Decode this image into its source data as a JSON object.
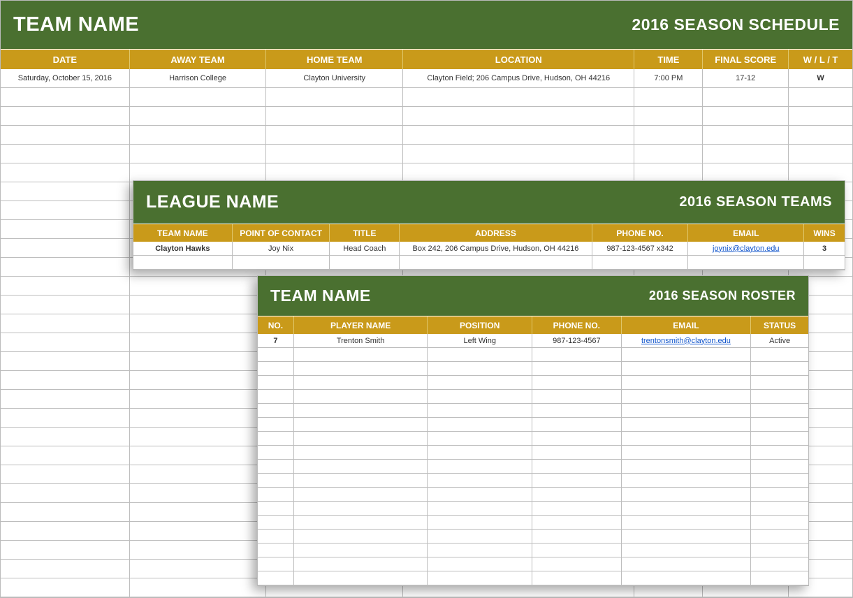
{
  "schedule": {
    "title": "TEAM NAME",
    "subtitle": "2016 SEASON SCHEDULE",
    "headers": [
      "DATE",
      "AWAY TEAM",
      "HOME TEAM",
      "LOCATION",
      "TIME",
      "FINAL SCORE",
      "W / L / T"
    ],
    "rows": [
      {
        "date": "Saturday, October 15, 2016",
        "away": "Harrison College",
        "home": "Clayton University",
        "location": "Clayton Field; 206 Campus Drive, Hudson, OH  44216",
        "time": "7:00 PM",
        "score": "17-12",
        "wlt": "W"
      }
    ],
    "empty_rows": 27
  },
  "teams": {
    "title": "LEAGUE NAME",
    "subtitle": "2016 SEASON TEAMS",
    "headers": [
      "TEAM NAME",
      "POINT OF CONTACT",
      "TITLE",
      "ADDRESS",
      "PHONE NO.",
      "EMAIL",
      "WINS"
    ],
    "rows": [
      {
        "team": "Clayton Hawks",
        "contact": "Joy Nix",
        "role": "Head Coach",
        "address": "Box 242, 206 Campus Drive, Hudson, OH  44216",
        "phone": "987-123-4567 x342",
        "email": "joynix@clayton.edu",
        "wins": "3"
      }
    ],
    "empty_rows": 1
  },
  "roster": {
    "title": "TEAM NAME",
    "subtitle": "2016 SEASON ROSTER",
    "headers": [
      "NO.",
      "PLAYER NAME",
      "POSITION",
      "PHONE NO.",
      "EMAIL",
      "STATUS"
    ],
    "rows": [
      {
        "no": "7",
        "name": "Trenton Smith",
        "position": "Left Wing",
        "phone": "987-123-4567",
        "email": "trentonsmith@clayton.edu",
        "status": "Active"
      }
    ],
    "empty_rows": 17
  }
}
